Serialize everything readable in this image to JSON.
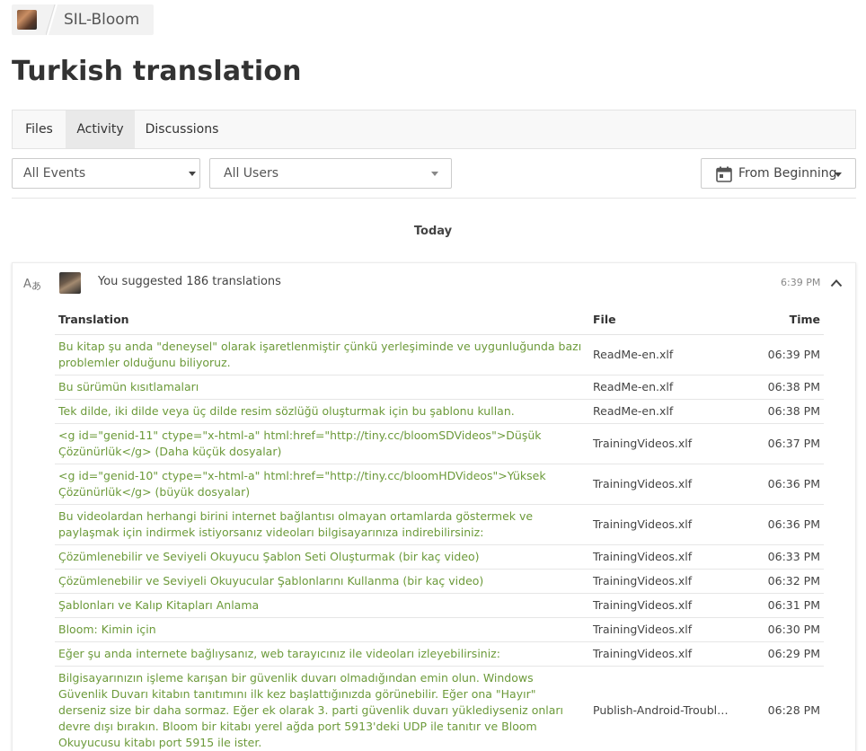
{
  "breadcrumb": {
    "project": "SIL-Bloom"
  },
  "page": {
    "title": "Turkish translation"
  },
  "tabs": [
    {
      "label": "Files",
      "active": false
    },
    {
      "label": "Activity",
      "active": true
    },
    {
      "label": "Discussions",
      "active": false
    }
  ],
  "filters": {
    "events": {
      "value": "All Events"
    },
    "users": {
      "value": "All Users"
    },
    "range": {
      "value": "From Beginning",
      "icon": "calendar-icon"
    }
  },
  "day_label": "Today",
  "event": {
    "icon": "translate-icon",
    "summary": "You suggested 186 translations",
    "time": "6:39 PM",
    "columns": {
      "translation": "Translation",
      "file": "File",
      "time": "Time"
    },
    "rows": [
      {
        "text": "Bu kitap şu anda \"deneysel\" olarak işaretlenmiştir çünkü yerleşiminde ve uygunluğunda bazı problemler olduğunu biliyoruz.",
        "file": "ReadMe-en.xlf",
        "time": "06:39 PM"
      },
      {
        "text": "Bu sürümün kısıtlamaları",
        "file": "ReadMe-en.xlf",
        "time": "06:38 PM"
      },
      {
        "text": "Tek dilde, iki dilde veya üç dilde resim sözlüğü oluşturmak için bu şablonu kullan.",
        "file": "ReadMe-en.xlf",
        "time": "06:38 PM"
      },
      {
        "text": "<g id=\"genid-11\" ctype=\"x-html-a\" html:href=\"http://tiny.cc/bloomSDVideos\">Düşük Çözünürlük</g> (Daha küçük dosyalar)",
        "file": "TrainingVideos.xlf",
        "time": "06:37 PM"
      },
      {
        "text": "<g id=\"genid-10\" ctype=\"x-html-a\" html:href=\"http://tiny.cc/bloomHDVideos\">Yüksek Çözünürlük</g> (büyük dosyalar)",
        "file": "TrainingVideos.xlf",
        "time": "06:36 PM"
      },
      {
        "text": "Bu videolardan herhangi birini internet bağlantısı olmayan ortamlarda göstermek ve paylaşmak için indirmek istiyorsanız videoları bilgisayarınıza indirebilirsiniz:",
        "file": "TrainingVideos.xlf",
        "time": "06:36 PM"
      },
      {
        "text": "Çözümlenebilir ve Seviyeli Okuyucu Şablon Seti Oluşturmak (bir kaç video)",
        "file": "TrainingVideos.xlf",
        "time": "06:33 PM"
      },
      {
        "text": "Çözümlenebilir ve Seviyeli Okuyucular Şablonlarını Kullanma (bir kaç video)",
        "file": "TrainingVideos.xlf",
        "time": "06:32 PM"
      },
      {
        "text": "Şablonları ve Kalıp Kitapları Anlama",
        "file": "TrainingVideos.xlf",
        "time": "06:31 PM"
      },
      {
        "text": "Bloom: Kimin için",
        "file": "TrainingVideos.xlf",
        "time": "06:30 PM"
      },
      {
        "text": "Eğer şu anda internete bağlıysanız, web tarayıcınız ile videoları izleyebilirsiniz:",
        "file": "TrainingVideos.xlf",
        "time": "06:29 PM"
      },
      {
        "text": "Bilgisayarınızın işleme karışan bir güvenlik duvarı olmadığından emin olun. Windows Güvenlik Duvarı kitabın tanıtımını ilk kez başlattığınızda görünebilir. Eğer ona \"Hayır\" derseniz size bir daha sormaz. Eğer ek olarak 3. parti güvenlik duvarı yüklediyseniz onları devre dışı bırakın. Bloom bir kitabı yerel ağda port 5913'deki UDP ile tanıtır ve Bloom Okuyucusu kitabı port 5915 ile ister.",
        "file": "Publish-Android-Troubleshooting.xlf",
        "time": "06:28 PM"
      }
    ]
  }
}
